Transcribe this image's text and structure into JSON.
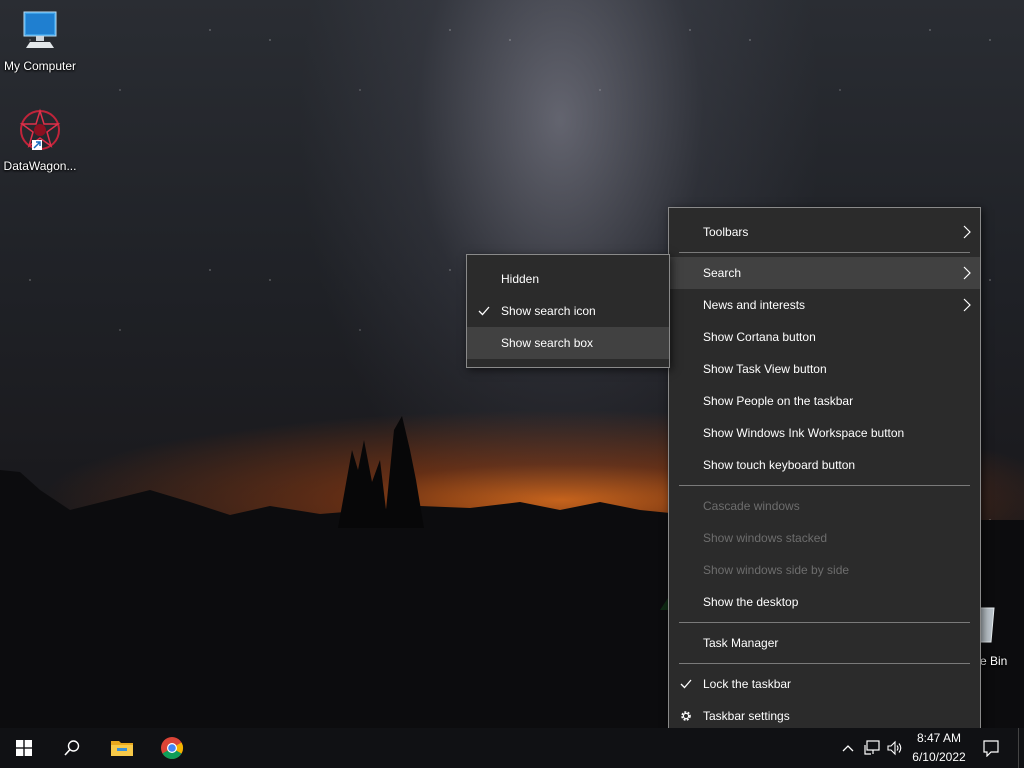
{
  "desktop": {
    "icons": [
      {
        "label": "My Computer"
      },
      {
        "label": "DataWagon..."
      },
      {
        "label": "e Bin"
      }
    ]
  },
  "context_menu": {
    "items": [
      {
        "label": "Toolbars",
        "submenu": true
      },
      {
        "label": "Search",
        "submenu": true,
        "highlighted": true
      },
      {
        "label": "News and interests",
        "submenu": true
      },
      {
        "label": "Show Cortana button"
      },
      {
        "label": "Show Task View button"
      },
      {
        "label": "Show People on the taskbar"
      },
      {
        "label": "Show Windows Ink Workspace button"
      },
      {
        "label": "Show touch keyboard button"
      },
      {
        "label": "Cascade windows",
        "disabled": true
      },
      {
        "label": "Show windows stacked",
        "disabled": true
      },
      {
        "label": "Show windows side by side",
        "disabled": true
      },
      {
        "label": "Show the desktop"
      },
      {
        "label": "Task Manager"
      },
      {
        "label": "Lock the taskbar",
        "checked": true
      },
      {
        "label": "Taskbar settings",
        "icon": "gear-icon"
      }
    ]
  },
  "search_submenu": {
    "items": [
      {
        "label": "Hidden"
      },
      {
        "label": "Show search icon",
        "checked": true
      },
      {
        "label": "Show search box",
        "highlighted": true
      }
    ]
  },
  "taskbar": {
    "apps": [
      "windows-start-icon",
      "search-icon",
      "file-explorer-icon",
      "chrome-icon"
    ],
    "tray": {
      "time": "8:47 AM",
      "date": "6/10/2022"
    }
  },
  "colors": {
    "menu_bg": "#2b2b2b",
    "menu_highlight": "#414141",
    "disabled_text": "#6d6d6d",
    "taskbar_bg": "#101114"
  }
}
